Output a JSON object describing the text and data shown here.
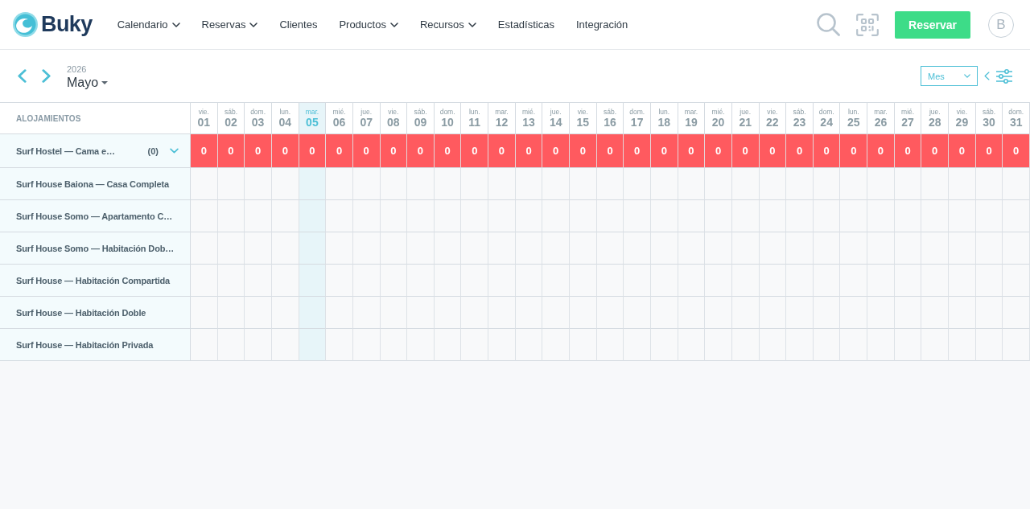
{
  "brand": {
    "name": "Buky"
  },
  "nav": [
    {
      "label": "Calendario",
      "dropdown": true
    },
    {
      "label": "Reservas",
      "dropdown": true
    },
    {
      "label": "Clientes",
      "dropdown": false
    },
    {
      "label": "Productos",
      "dropdown": true
    },
    {
      "label": "Recursos",
      "dropdown": true
    },
    {
      "label": "Estadísticas",
      "dropdown": false
    },
    {
      "label": "Integración",
      "dropdown": false
    }
  ],
  "actions": {
    "book_button": "Reservar",
    "avatar": "B"
  },
  "toolbar": {
    "year": "2026",
    "month": "Mayo",
    "view_select": {
      "value": "Mes"
    }
  },
  "table": {
    "first_column": "ALOJAMIENTOS",
    "days": [
      {
        "weekday": "vie.",
        "day": "01",
        "selected": false
      },
      {
        "weekday": "sáb.",
        "day": "02",
        "selected": false
      },
      {
        "weekday": "dom.",
        "day": "03",
        "selected": false
      },
      {
        "weekday": "lun.",
        "day": "04",
        "selected": false
      },
      {
        "weekday": "mar.",
        "day": "05",
        "selected": true
      },
      {
        "weekday": "mié.",
        "day": "06",
        "selected": false
      },
      {
        "weekday": "jue.",
        "day": "07",
        "selected": false
      },
      {
        "weekday": "vie.",
        "day": "08",
        "selected": false
      },
      {
        "weekday": "sáb.",
        "day": "09",
        "selected": false
      },
      {
        "weekday": "dom.",
        "day": "10",
        "selected": false
      },
      {
        "weekday": "lun.",
        "day": "11",
        "selected": false
      },
      {
        "weekday": "mar.",
        "day": "12",
        "selected": false
      },
      {
        "weekday": "mié.",
        "day": "13",
        "selected": false
      },
      {
        "weekday": "jue.",
        "day": "14",
        "selected": false
      },
      {
        "weekday": "vie.",
        "day": "15",
        "selected": false
      },
      {
        "weekday": "sáb.",
        "day": "16",
        "selected": false
      },
      {
        "weekday": "dom.",
        "day": "17",
        "selected": false
      },
      {
        "weekday": "lun.",
        "day": "18",
        "selected": false
      },
      {
        "weekday": "mar.",
        "day": "19",
        "selected": false
      },
      {
        "weekday": "mié.",
        "day": "20",
        "selected": false
      },
      {
        "weekday": "jue.",
        "day": "21",
        "selected": false
      },
      {
        "weekday": "vie.",
        "day": "22",
        "selected": false
      },
      {
        "weekday": "sáb.",
        "day": "23",
        "selected": false
      },
      {
        "weekday": "dom.",
        "day": "24",
        "selected": false
      },
      {
        "weekday": "lun.",
        "day": "25",
        "selected": false
      },
      {
        "weekday": "mar.",
        "day": "26",
        "selected": false
      },
      {
        "weekday": "mié.",
        "day": "27",
        "selected": false
      },
      {
        "weekday": "jue.",
        "day": "28",
        "selected": false
      },
      {
        "weekday": "vie.",
        "day": "29",
        "selected": false
      },
      {
        "weekday": "sáb.",
        "day": "30",
        "selected": false
      },
      {
        "weekday": "dom.",
        "day": "31",
        "selected": false
      }
    ],
    "rows": [
      {
        "kind": "summary",
        "name": "Surf Hostel — Cama e…",
        "count": "(0)",
        "values": [
          "0",
          "0",
          "0",
          "0",
          "0",
          "0",
          "0",
          "0",
          "0",
          "0",
          "0",
          "0",
          "0",
          "0",
          "0",
          "0",
          "0",
          "0",
          "0",
          "0",
          "0",
          "0",
          "0",
          "0",
          "0",
          "0",
          "0",
          "0",
          "0",
          "0",
          "0"
        ]
      },
      {
        "kind": "resource",
        "name": "Surf House Baiona — Casa Completa"
      },
      {
        "kind": "resource",
        "name": "Surf House Somo — Apartamento C…"
      },
      {
        "kind": "resource",
        "name": "Surf House Somo — Habitación Dob…"
      },
      {
        "kind": "resource",
        "name": "Surf House — Habitación Compartida"
      },
      {
        "kind": "resource",
        "name": "Surf House — Habitación Doble"
      },
      {
        "kind": "resource",
        "name": "Surf House — Habitación Privada"
      }
    ]
  }
}
